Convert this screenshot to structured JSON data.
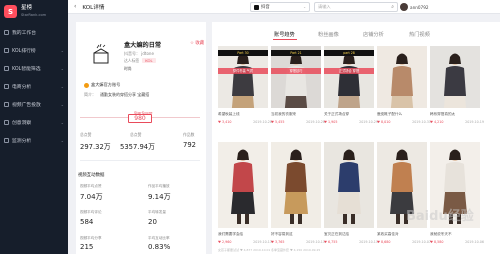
{
  "brand": {
    "name": "星榜",
    "url": "StarRank.com",
    "mark": "S"
  },
  "sidebar": {
    "items": [
      {
        "label": "我的工作台",
        "chev": ""
      },
      {
        "label": "KOL排行榜",
        "chev": "⌄"
      },
      {
        "label": "KOL智能筛选",
        "chev": "⌄"
      },
      {
        "label": "电商分析",
        "chev": "⌄"
      },
      {
        "label": "视频广告投放",
        "chev": "⌄"
      },
      {
        "label": "创意洞察",
        "chev": "⌄"
      },
      {
        "label": "监测分析",
        "chev": "⌄"
      }
    ]
  },
  "topbar": {
    "back": "‹",
    "title": "KOL详情",
    "platform": "抖音",
    "platform_caret": "⌄",
    "search_placeholder": "请输入",
    "search_icon": "⌕",
    "username": "ann0792"
  },
  "profile": {
    "name": "盒大嫲的日常",
    "follow": "☆ 收藏",
    "id": "抖音号：  jdtone",
    "tag_label": "达人标签",
    "tag": "KOL",
    "category": "时尚",
    "verified": "盒大嫲官方账号",
    "bio_label": "简介：",
    "bio": "通勤女装的穿搭分享 宝藏搭",
    "score_label": "StarScore",
    "score": "980",
    "stats": [
      {
        "label": "总点赞",
        "value": "297.32万"
      },
      {
        "label": "总点赞",
        "value": "5357.94万"
      },
      {
        "label": "作品数",
        "value": "792"
      }
    ]
  },
  "metrics": {
    "title": "视频互动数据",
    "items": [
      {
        "label": "视频平均点赞",
        "value": "7.04万"
      },
      {
        "label": "作品平均播放",
        "value": "9.14万"
      },
      {
        "label": "视频平均评论",
        "value": "584"
      },
      {
        "label": "平均转发量",
        "value": "20"
      },
      {
        "label": "视频平均分享",
        "value": "215"
      },
      {
        "label": "平均互动比率",
        "value": "0.83%"
      }
    ]
  },
  "tabs": [
    {
      "label": "账号趋势"
    },
    {
      "label": "粉丝画像"
    },
    {
      "label": "店铺分析"
    },
    {
      "label": "热门视频"
    }
  ],
  "videos": [
    {
      "desc": "希望秋装上线 ",
      "likes": "♥ 3,410",
      "date": "2019.10.28",
      "banner": "Part 30",
      "caption": "穿件冬装 气质"
    },
    {
      "desc": "当初我的衣服来",
      "likes": "♥ 5,455",
      "date": "2019.10.28",
      "banner": "Part 21",
      "caption": "穿搭技巧"
    },
    {
      "desc": "关于正式场合穿",
      "likes": "♥ 1,905",
      "date": "2019.10.29",
      "banner": "part 28",
      "caption": "正式场合 穿搭"
    },
    {
      "desc": "鹿皮靴子配什么",
      "likes": "♥ 8,010",
      "date": "2019.10.31",
      "banner": "",
      "caption": ""
    },
    {
      "desc": "韩系穿搭真的太",
      "likes": "♥ 4,210",
      "date": "2019.10.19",
      "banner": "",
      "caption": ""
    },
    {
      "desc": "我们需要学会给",
      "likes": "♥ 2,960",
      "date": "2019.10.13",
      "banner": "",
      "caption": ""
    },
    {
      "desc": "好不容易到这",
      "likes": "♥ 3,765",
      "date": "2019.10.11",
      "banner": "",
      "caption": ""
    },
    {
      "desc": "宝贝正在到达给",
      "likes": "♥ 6,755",
      "date": "2019.10.11",
      "banner": "",
      "caption": ""
    },
    {
      "desc": "某收买高佳对",
      "likes": "♥ 8,680",
      "date": "2019.10.07",
      "banner": "",
      "caption": ""
    },
    {
      "desc": "我就说冬天不",
      "likes": "♥ 8,580",
      "date": "2019.10.06",
      "banner": "",
      "caption": ""
    },
    {
      "desc": "女孩子都要试试",
      "likes": "♥ 4,877",
      "date": "2019.10.01",
      "banner": "",
      "caption": ""
    },
    {
      "desc": "冬季宝藏外套",
      "likes": "♥ 4,150",
      "date": "2019.09.25",
      "banner": "",
      "caption": ""
    }
  ],
  "watermark": "Baidu经验",
  "colors": {
    "accent": "#e94b5b",
    "sidebar": "#161e2b"
  }
}
